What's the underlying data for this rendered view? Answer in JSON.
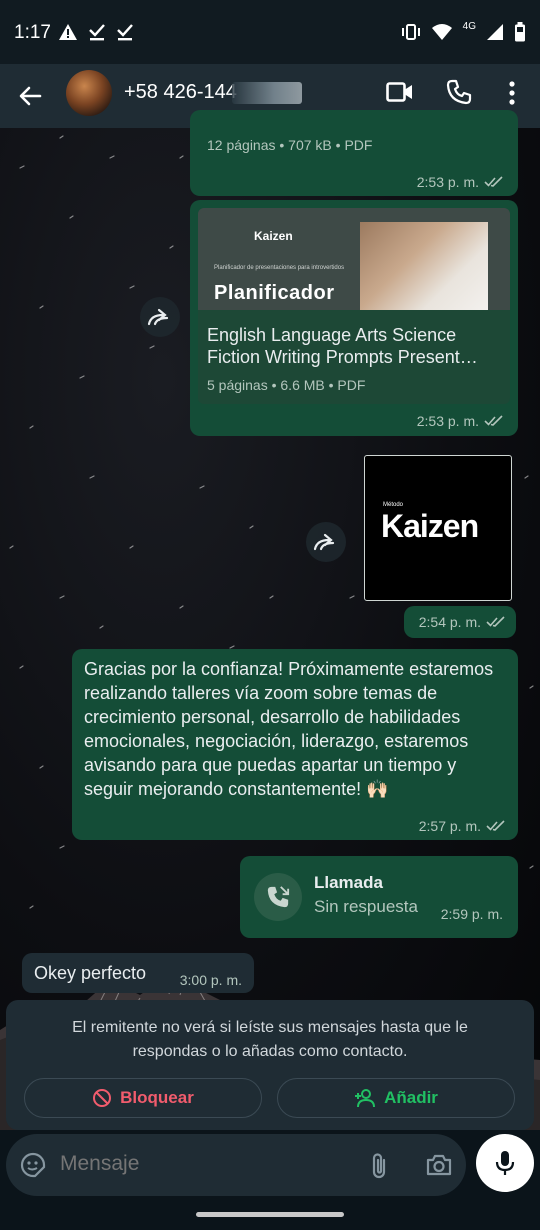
{
  "status_bar": {
    "time": "1:17",
    "network": "4G"
  },
  "header": {
    "contact": "+58 426-144",
    "icons": [
      "back-arrow-icon",
      "video-call-icon",
      "voice-call-icon",
      "more-options-icon"
    ]
  },
  "messages": {
    "doc1": {
      "info": "12 páginas • 707 kB • PDF",
      "time": "2:53 p. m."
    },
    "doc2": {
      "thumb_brand": "Kaizen",
      "thumb_subtitle": "Planificador de presentaciones para introvertidos",
      "thumb_title": "Planificador",
      "title": "English Language Arts Science Fiction Writing Prompts Present…",
      "info": "5 páginas • 6.6 MB • PDF",
      "time": "2:53 p. m."
    },
    "image": {
      "small_label": "Método",
      "brand": "Kaizen",
      "time": "2:54 p. m."
    },
    "text": {
      "body": "Gracias por la confianza! Próximamente estaremos realizando talleres vía zoom sobre temas de crecimiento personal, desarrollo de habilidades emocionales, negociación, liderazgo, estaremos avisando para que puedas apartar un tiempo y seguir mejorando constantemente! 🙌🏻",
      "time": "2:57 p. m."
    },
    "call": {
      "title": "Llamada",
      "subtitle": "Sin respuesta",
      "time": "2:59 p. m."
    },
    "incoming": {
      "text": "Okey perfecto",
      "time": "3:00 p. m."
    }
  },
  "notice": {
    "text": "El remitente no verá si leíste sus mensajes hasta que le respondas o lo añadas como contacto.",
    "block_label": "Bloquear",
    "add_label": "Añadir"
  },
  "composer": {
    "placeholder": "Mensaje"
  },
  "colors": {
    "outgoing_bubble": "#144d37",
    "incoming_bubble": "#1f2c34",
    "accent_green": "#25d366",
    "danger_red": "#f15c6d"
  }
}
